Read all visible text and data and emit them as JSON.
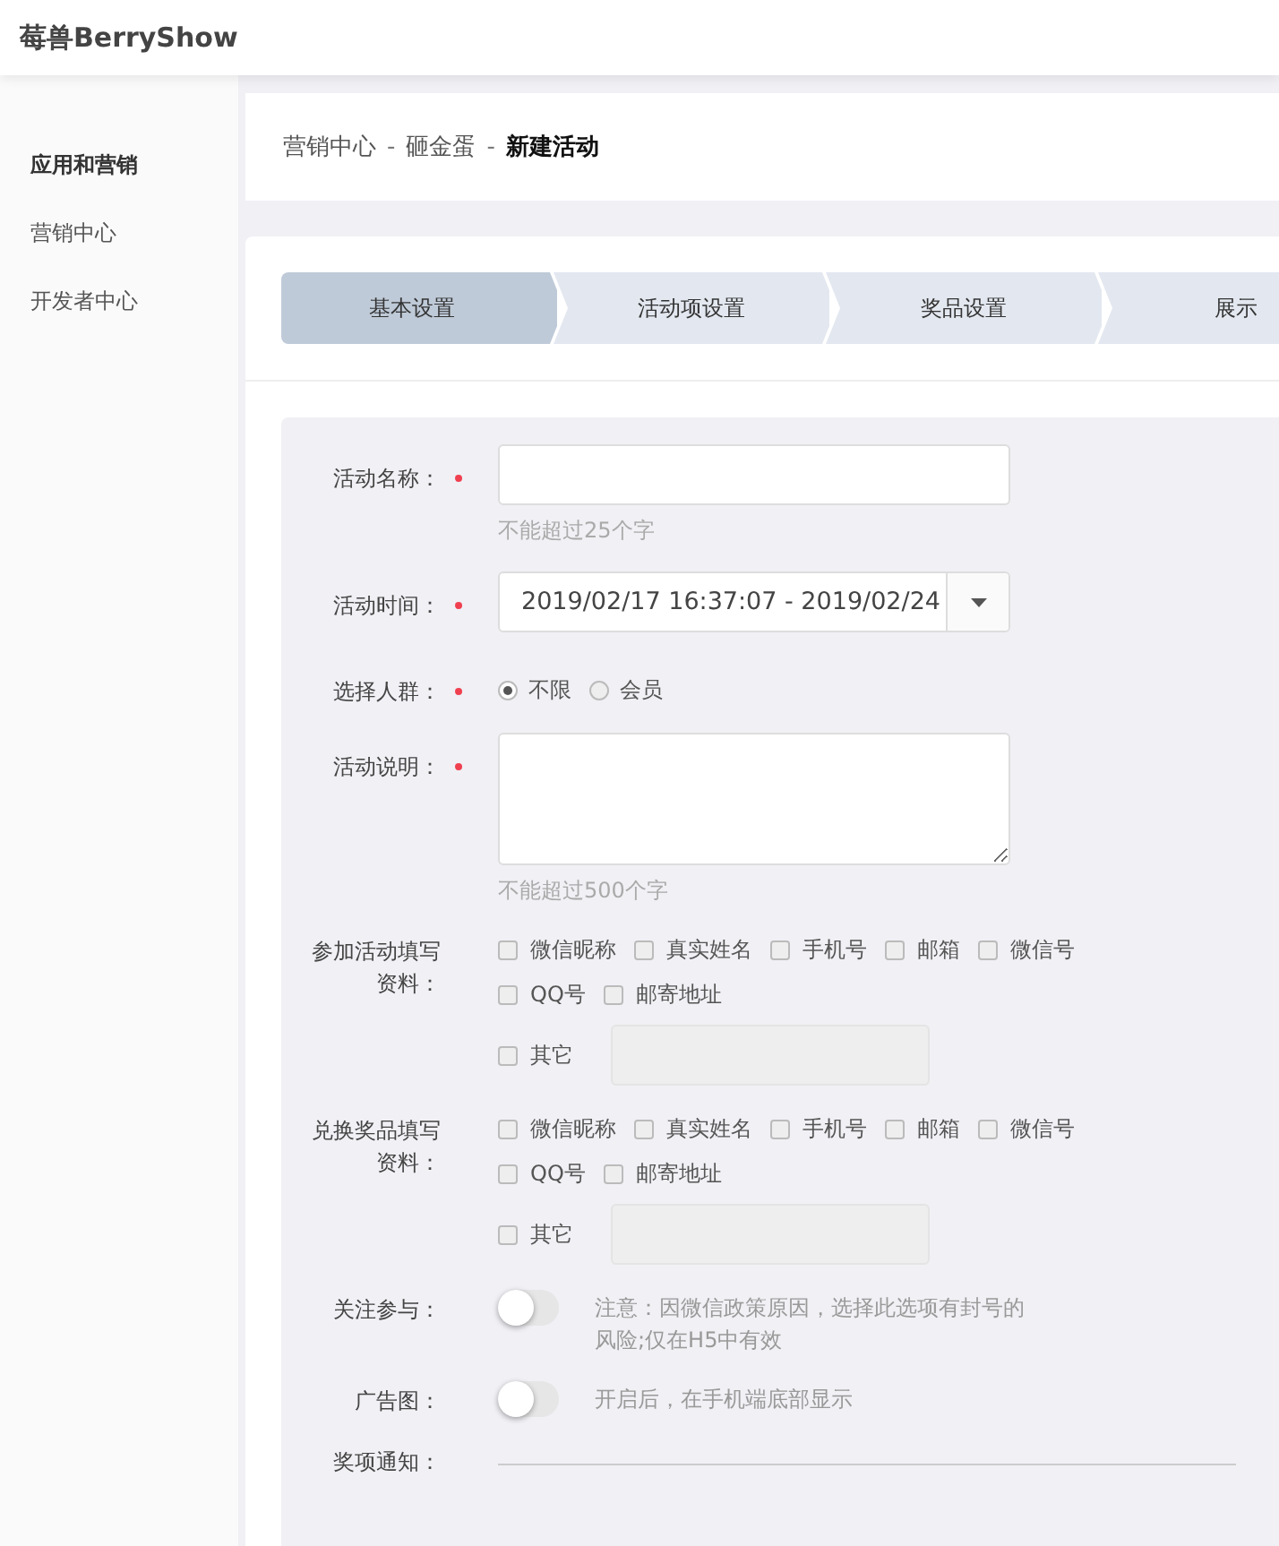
{
  "header": {
    "brand": "莓兽BerryShow"
  },
  "sidebar": {
    "heading": "应用和营销",
    "items": [
      {
        "label": "营销中心",
        "selected": false
      },
      {
        "label": "开发者中心",
        "selected": false
      }
    ]
  },
  "breadcrumb": {
    "items": [
      "营销中心",
      "砸金蛋"
    ],
    "separator": "-",
    "current": "新建活动"
  },
  "steps": [
    {
      "label": "基本设置",
      "selected": true
    },
    {
      "label": "活动项设置",
      "selected": false
    },
    {
      "label": "奖品设置",
      "selected": false
    },
    {
      "label": "展示",
      "selected": false
    }
  ],
  "form": [
    {
      "kind": "text",
      "label": "活动名称：",
      "required": true,
      "hint": "不能超过25个字"
    },
    {
      "kind": "select",
      "label": "活动时间：",
      "required": true,
      "value": "2019/02/17 16:37:07 - 2019/02/24"
    },
    {
      "kind": "radio",
      "label": "选择人群：",
      "required": true,
      "options": [
        {
          "label": "不限",
          "selected": true
        },
        {
          "label": "会员",
          "selected": false
        }
      ]
    },
    {
      "kind": "textarea",
      "label": "活动说明：",
      "required": true,
      "hint": "不能超过500个字"
    },
    {
      "kind": "checks",
      "label": "参加活动填写资料：",
      "required": false,
      "options": [
        {
          "label": "微信昵称",
          "checked": false
        },
        {
          "label": "真实姓名",
          "checked": false
        },
        {
          "label": "手机号",
          "checked": false
        },
        {
          "label": "邮箱",
          "checked": false
        },
        {
          "label": "微信号",
          "checked": false
        },
        {
          "label": "QQ号",
          "checked": false
        },
        {
          "label": "邮寄地址",
          "checked": false
        }
      ],
      "other": {
        "label": "其它",
        "checked": false
      }
    },
    {
      "kind": "checks",
      "label": "兑换奖品填写资料：",
      "required": false,
      "options": [
        {
          "label": "微信昵称",
          "checked": false
        },
        {
          "label": "真实姓名",
          "checked": false
        },
        {
          "label": "手机号",
          "checked": false
        },
        {
          "label": "邮箱",
          "checked": false
        },
        {
          "label": "微信号",
          "checked": false
        },
        {
          "label": "QQ号",
          "checked": false
        },
        {
          "label": "邮寄地址",
          "checked": false
        }
      ],
      "other": {
        "label": "其它",
        "checked": false
      }
    },
    {
      "kind": "toggle",
      "label": "关注参与：",
      "required": false,
      "on": false,
      "note": "注意：因微信政策原因，选择此选项有封号的风险;仅在H5中有效"
    },
    {
      "kind": "toggle",
      "label": "广告图：",
      "required": false,
      "on": false,
      "note": "开启后，在手机端底部显示"
    },
    {
      "kind": "line",
      "label": "奖项通知：",
      "required": false
    }
  ]
}
